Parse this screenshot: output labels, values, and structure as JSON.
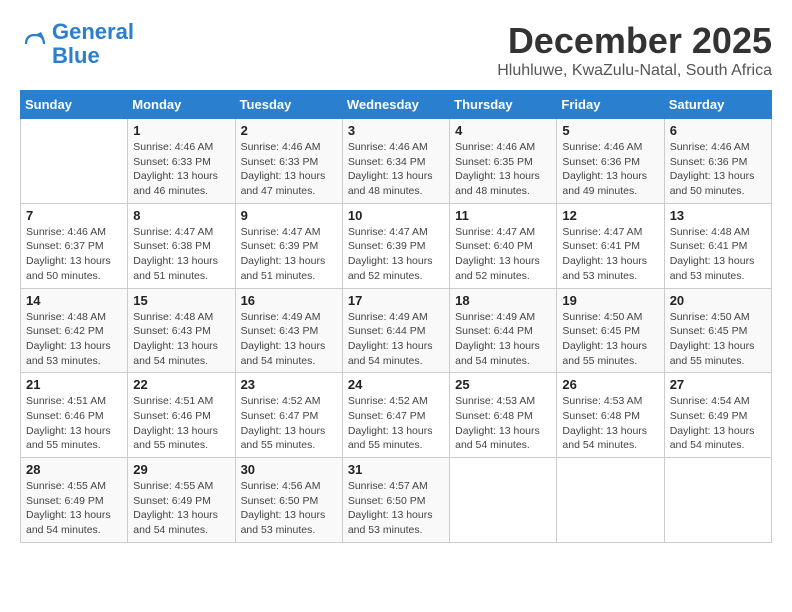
{
  "header": {
    "logo_line1": "General",
    "logo_line2": "Blue",
    "month": "December 2025",
    "location": "Hluhluwe, KwaZulu-Natal, South Africa"
  },
  "days_of_week": [
    "Sunday",
    "Monday",
    "Tuesday",
    "Wednesday",
    "Thursday",
    "Friday",
    "Saturday"
  ],
  "weeks": [
    [
      {
        "day": "",
        "sunrise": "",
        "sunset": "",
        "daylight": ""
      },
      {
        "day": "1",
        "sunrise": "Sunrise: 4:46 AM",
        "sunset": "Sunset: 6:33 PM",
        "daylight": "Daylight: 13 hours and 46 minutes."
      },
      {
        "day": "2",
        "sunrise": "Sunrise: 4:46 AM",
        "sunset": "Sunset: 6:33 PM",
        "daylight": "Daylight: 13 hours and 47 minutes."
      },
      {
        "day": "3",
        "sunrise": "Sunrise: 4:46 AM",
        "sunset": "Sunset: 6:34 PM",
        "daylight": "Daylight: 13 hours and 48 minutes."
      },
      {
        "day": "4",
        "sunrise": "Sunrise: 4:46 AM",
        "sunset": "Sunset: 6:35 PM",
        "daylight": "Daylight: 13 hours and 48 minutes."
      },
      {
        "day": "5",
        "sunrise": "Sunrise: 4:46 AM",
        "sunset": "Sunset: 6:36 PM",
        "daylight": "Daylight: 13 hours and 49 minutes."
      },
      {
        "day": "6",
        "sunrise": "Sunrise: 4:46 AM",
        "sunset": "Sunset: 6:36 PM",
        "daylight": "Daylight: 13 hours and 50 minutes."
      }
    ],
    [
      {
        "day": "7",
        "sunrise": "Sunrise: 4:46 AM",
        "sunset": "Sunset: 6:37 PM",
        "daylight": "Daylight: 13 hours and 50 minutes."
      },
      {
        "day": "8",
        "sunrise": "Sunrise: 4:47 AM",
        "sunset": "Sunset: 6:38 PM",
        "daylight": "Daylight: 13 hours and 51 minutes."
      },
      {
        "day": "9",
        "sunrise": "Sunrise: 4:47 AM",
        "sunset": "Sunset: 6:39 PM",
        "daylight": "Daylight: 13 hours and 51 minutes."
      },
      {
        "day": "10",
        "sunrise": "Sunrise: 4:47 AM",
        "sunset": "Sunset: 6:39 PM",
        "daylight": "Daylight: 13 hours and 52 minutes."
      },
      {
        "day": "11",
        "sunrise": "Sunrise: 4:47 AM",
        "sunset": "Sunset: 6:40 PM",
        "daylight": "Daylight: 13 hours and 52 minutes."
      },
      {
        "day": "12",
        "sunrise": "Sunrise: 4:47 AM",
        "sunset": "Sunset: 6:41 PM",
        "daylight": "Daylight: 13 hours and 53 minutes."
      },
      {
        "day": "13",
        "sunrise": "Sunrise: 4:48 AM",
        "sunset": "Sunset: 6:41 PM",
        "daylight": "Daylight: 13 hours and 53 minutes."
      }
    ],
    [
      {
        "day": "14",
        "sunrise": "Sunrise: 4:48 AM",
        "sunset": "Sunset: 6:42 PM",
        "daylight": "Daylight: 13 hours and 53 minutes."
      },
      {
        "day": "15",
        "sunrise": "Sunrise: 4:48 AM",
        "sunset": "Sunset: 6:43 PM",
        "daylight": "Daylight: 13 hours and 54 minutes."
      },
      {
        "day": "16",
        "sunrise": "Sunrise: 4:49 AM",
        "sunset": "Sunset: 6:43 PM",
        "daylight": "Daylight: 13 hours and 54 minutes."
      },
      {
        "day": "17",
        "sunrise": "Sunrise: 4:49 AM",
        "sunset": "Sunset: 6:44 PM",
        "daylight": "Daylight: 13 hours and 54 minutes."
      },
      {
        "day": "18",
        "sunrise": "Sunrise: 4:49 AM",
        "sunset": "Sunset: 6:44 PM",
        "daylight": "Daylight: 13 hours and 54 minutes."
      },
      {
        "day": "19",
        "sunrise": "Sunrise: 4:50 AM",
        "sunset": "Sunset: 6:45 PM",
        "daylight": "Daylight: 13 hours and 55 minutes."
      },
      {
        "day": "20",
        "sunrise": "Sunrise: 4:50 AM",
        "sunset": "Sunset: 6:45 PM",
        "daylight": "Daylight: 13 hours and 55 minutes."
      }
    ],
    [
      {
        "day": "21",
        "sunrise": "Sunrise: 4:51 AM",
        "sunset": "Sunset: 6:46 PM",
        "daylight": "Daylight: 13 hours and 55 minutes."
      },
      {
        "day": "22",
        "sunrise": "Sunrise: 4:51 AM",
        "sunset": "Sunset: 6:46 PM",
        "daylight": "Daylight: 13 hours and 55 minutes."
      },
      {
        "day": "23",
        "sunrise": "Sunrise: 4:52 AM",
        "sunset": "Sunset: 6:47 PM",
        "daylight": "Daylight: 13 hours and 55 minutes."
      },
      {
        "day": "24",
        "sunrise": "Sunrise: 4:52 AM",
        "sunset": "Sunset: 6:47 PM",
        "daylight": "Daylight: 13 hours and 55 minutes."
      },
      {
        "day": "25",
        "sunrise": "Sunrise: 4:53 AM",
        "sunset": "Sunset: 6:48 PM",
        "daylight": "Daylight: 13 hours and 54 minutes."
      },
      {
        "day": "26",
        "sunrise": "Sunrise: 4:53 AM",
        "sunset": "Sunset: 6:48 PM",
        "daylight": "Daylight: 13 hours and 54 minutes."
      },
      {
        "day": "27",
        "sunrise": "Sunrise: 4:54 AM",
        "sunset": "Sunset: 6:49 PM",
        "daylight": "Daylight: 13 hours and 54 minutes."
      }
    ],
    [
      {
        "day": "28",
        "sunrise": "Sunrise: 4:55 AM",
        "sunset": "Sunset: 6:49 PM",
        "daylight": "Daylight: 13 hours and 54 minutes."
      },
      {
        "day": "29",
        "sunrise": "Sunrise: 4:55 AM",
        "sunset": "Sunset: 6:49 PM",
        "daylight": "Daylight: 13 hours and 54 minutes."
      },
      {
        "day": "30",
        "sunrise": "Sunrise: 4:56 AM",
        "sunset": "Sunset: 6:50 PM",
        "daylight": "Daylight: 13 hours and 53 minutes."
      },
      {
        "day": "31",
        "sunrise": "Sunrise: 4:57 AM",
        "sunset": "Sunset: 6:50 PM",
        "daylight": "Daylight: 13 hours and 53 minutes."
      },
      {
        "day": "",
        "sunrise": "",
        "sunset": "",
        "daylight": ""
      },
      {
        "day": "",
        "sunrise": "",
        "sunset": "",
        "daylight": ""
      },
      {
        "day": "",
        "sunrise": "",
        "sunset": "",
        "daylight": ""
      }
    ]
  ]
}
